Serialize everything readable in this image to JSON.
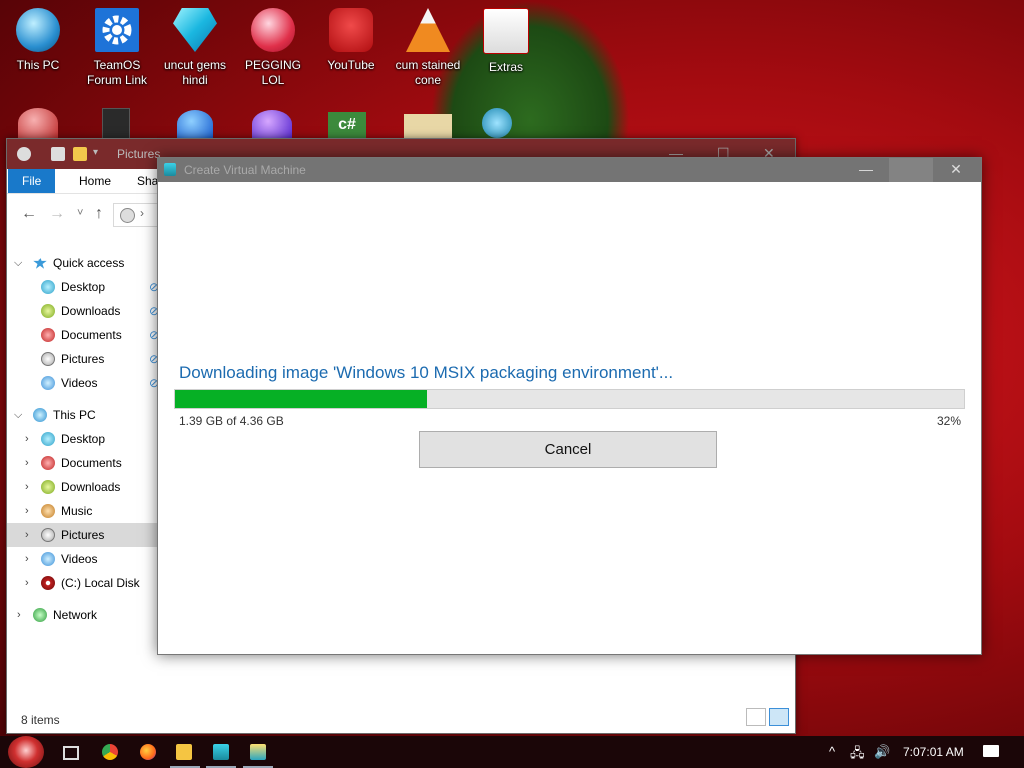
{
  "desktop": {
    "icons": [
      {
        "label": "This PC",
        "icon": "this-pc-icon"
      },
      {
        "label": "TeamOS Forum Link",
        "icon": "gear-icon"
      },
      {
        "label": "uncut gems hindi",
        "icon": "diamond-icon"
      },
      {
        "label": "PEGGING LOL",
        "icon": "p-logo-icon"
      },
      {
        "label": "YouTube",
        "icon": "angry-bird-icon"
      },
      {
        "label": "cum stained cone",
        "icon": "cone-icon"
      },
      {
        "label": "Extras",
        "icon": "extras-icon"
      }
    ]
  },
  "explorer": {
    "title": "Pictures",
    "ribbon_tabs": [
      "File",
      "Home",
      "Sha"
    ],
    "nav": {
      "back": "←",
      "forward": "→",
      "recent": "˅",
      "up": "↑"
    },
    "tree": {
      "quick_access": "Quick access",
      "quick_items": [
        "Desktop",
        "Downloads",
        "Documents",
        "Pictures",
        "Videos"
      ],
      "this_pc": "This PC",
      "pc_items": [
        "Desktop",
        "Documents",
        "Downloads",
        "Music",
        "Pictures",
        "Videos",
        "(C:) Local Disk"
      ],
      "network": "Network",
      "selected": "Pictures"
    },
    "status": "8 items",
    "window_controls": {
      "minimize": "—",
      "maximize": "☐",
      "close": "✕"
    }
  },
  "dialog": {
    "title": "Create Virtual Machine",
    "message": "Downloading image 'Windows 10 MSIX packaging environment'...",
    "progress": {
      "fraction": 0.32,
      "size_text": "1.39 GB of 4.36 GB",
      "percent_text": "32%",
      "color": "#06b025"
    },
    "cancel_label": "Cancel",
    "window_controls": {
      "minimize": "—",
      "close": "✕"
    }
  },
  "taskbar": {
    "icons": [
      "start-orb-icon",
      "task-view-icon",
      "chrome-icon",
      "firefox-icon",
      "file-explorer-icon",
      "calculator-icon",
      "hyper-v-quick-create-icon"
    ],
    "tray": {
      "chevron": "^",
      "network": "🖧",
      "volume": "🔊"
    },
    "clock": "7:07:01 AM"
  }
}
